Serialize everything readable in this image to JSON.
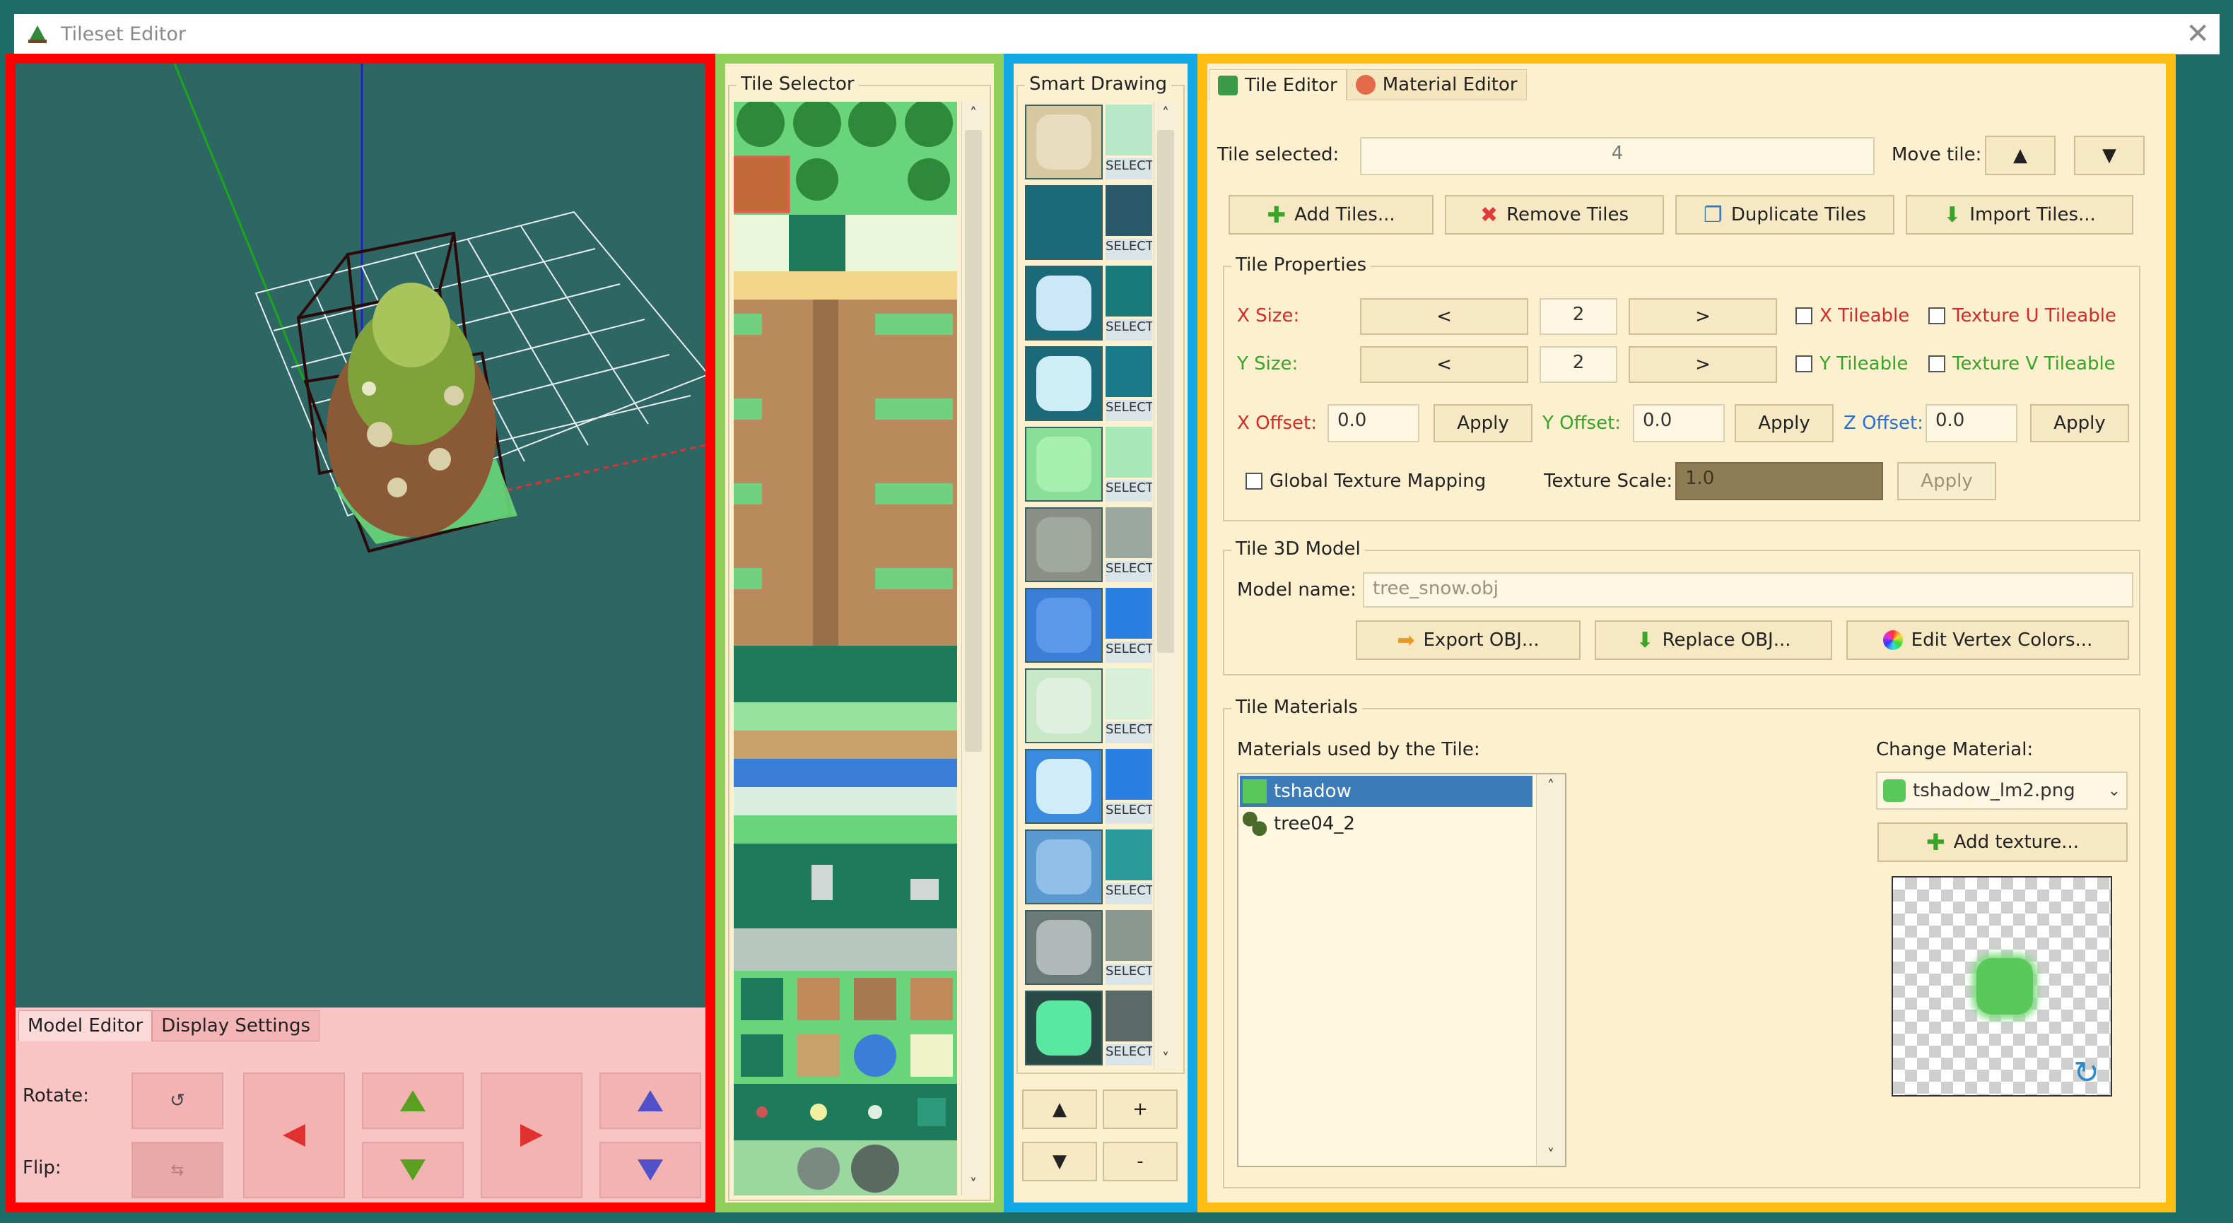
{
  "window": {
    "title": "Tileset Editor",
    "close_glyph": "✕"
  },
  "model_panel": {
    "tabs": [
      "Model Editor",
      "Display Settings"
    ],
    "rotate_label": "Rotate:",
    "flip_label": "Flip:",
    "colors": {
      "arrow_red": "#e03030",
      "arrow_green": "#5aa020",
      "arrow_blue": "#5050c8"
    }
  },
  "tile_selector": {
    "title": "Tile Selector"
  },
  "smart_drawing": {
    "title": "Smart Drawing",
    "select_label": "SELECT",
    "buttons": {
      "up": "▲",
      "down": "▼",
      "add": "+",
      "remove": "-"
    }
  },
  "tile_editor": {
    "tabs": [
      "Tile Editor",
      "Material Editor"
    ],
    "tile_selected_label": "Tile selected:",
    "tile_selected_value": "4",
    "move_tile_label": "Move tile:",
    "move_up": "▲",
    "move_down": "▼",
    "actions": [
      "Add Tiles...",
      "Remove Tiles",
      "Duplicate Tiles",
      "Import Tiles..."
    ],
    "tile_properties": {
      "title": "Tile Properties",
      "x_size_label": "X Size:",
      "y_size_label": "Y Size:",
      "x_size_value": "2",
      "y_size_value": "2",
      "dec": "<",
      "inc": ">",
      "x_tileable": "X Tileable",
      "y_tileable": "Y Tileable",
      "tex_u_tileable": "Texture U Tileable",
      "tex_v_tileable": "Texture V Tileable",
      "x_offset_label": "X Offset:",
      "y_offset_label": "Y Offset:",
      "z_offset_label": "Z Offset:",
      "x_offset": "0.0",
      "y_offset": "0.0",
      "z_offset": "0.0",
      "apply": "Apply",
      "global_texture_mapping": "Global Texture Mapping",
      "texture_scale_label": "Texture Scale:",
      "texture_scale": "1.0",
      "colors": {
        "x": "#d62a2a",
        "y": "#3aa32a",
        "z": "#2a6fd6"
      }
    },
    "tile_3d_model": {
      "title": "Tile 3D Model",
      "model_name_label": "Model name:",
      "model_name": "tree_snow.obj",
      "export_obj": "Export OBJ...",
      "replace_obj": "Replace OBJ...",
      "edit_vertex_colors": "Edit Vertex Colors..."
    },
    "tile_materials": {
      "title": "Tile Materials",
      "used_label": "Materials used by the Tile:",
      "materials": [
        "tshadow",
        "tree04_2"
      ],
      "change_material_label": "Change Material:",
      "selected_material": "tshadow_lm2.png",
      "add_texture": "Add texture..."
    }
  }
}
